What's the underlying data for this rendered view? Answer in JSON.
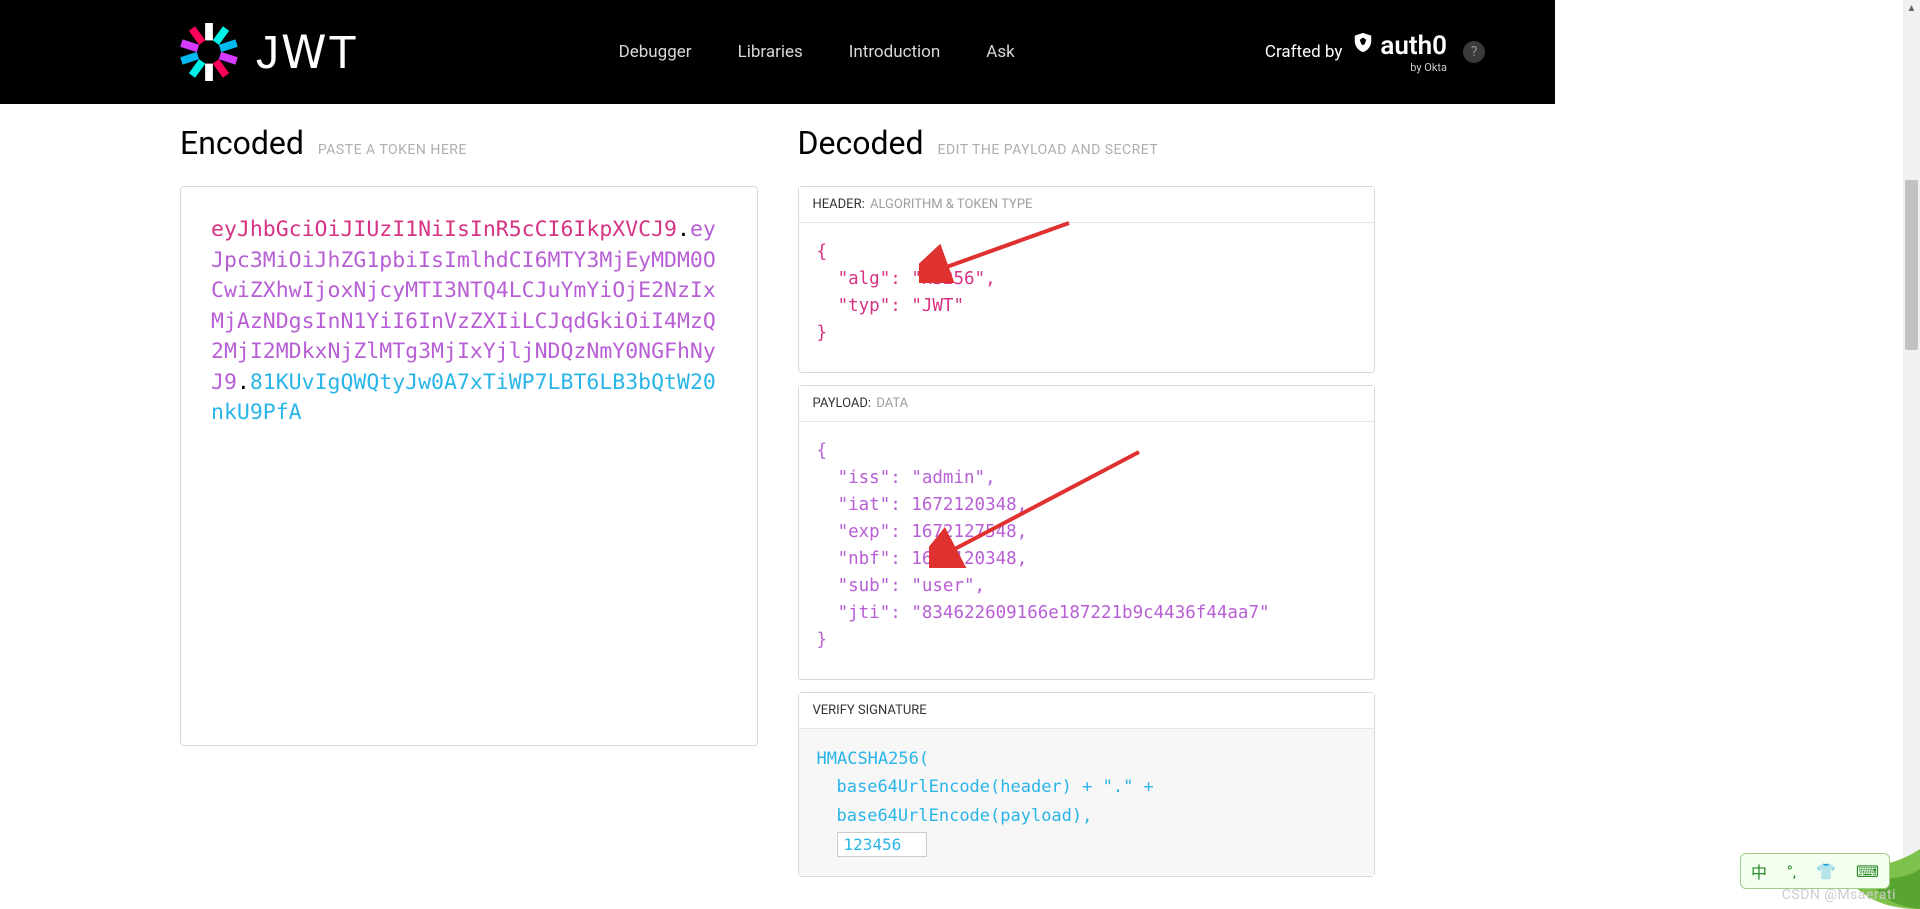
{
  "nav": {
    "links": {
      "debugger": "Debugger",
      "libraries": "Libraries",
      "introduction": "Introduction",
      "ask": "Ask"
    },
    "crafted_by": "Crafted by",
    "auth0": "auth0",
    "by_okta": "by Okta",
    "help": "?"
  },
  "encoded": {
    "title": "Encoded",
    "subtitle": "PASTE A TOKEN HERE",
    "token_header": "eyJhbGciOiJIUzI1NiIsInR5cCI6IkpXVCJ9",
    "token_payload": "eyJpc3MiOiJhZG1pbiIsImlhdCI6MTY3MjEyMDM0OCwiZXhwIjoxNjcyMTI3NTQ4LCJuYmYiOjE2NzIxMjAzNDgsInN1YiI6InVzZXIiLCJqdGkiOiI4MzQ2MjI2MDkxNjZlMTg3MjIxYjljNDQzNmY0NGFhNyJ9",
    "token_signature": "81KUvIgQWQtyJw0A7xTiWP7LBT6LB3bQtW20nkU9PfA"
  },
  "decoded": {
    "title": "Decoded",
    "subtitle": "EDIT THE PAYLOAD AND SECRET",
    "header_label": "HEADER:",
    "header_sublabel": "ALGORITHM & TOKEN TYPE",
    "header_json": {
      "alg": "HS256",
      "typ": "JWT"
    },
    "payload_label": "PAYLOAD:",
    "payload_sublabel": "DATA",
    "payload_json": {
      "iss": "admin",
      "iat": 1672120348,
      "exp": 1672127548,
      "nbf": 1672120348,
      "sub": "user",
      "jti": "834622609166e187221b9c4436f44aa7"
    },
    "sig_label": "VERIFY SIGNATURE",
    "sig": {
      "fn": "HMACSHA256(",
      "l1": "base64UrlEncode(header) + \".\" +",
      "l2": "base64UrlEncode(payload),",
      "secret": "123456"
    }
  },
  "ime": {
    "zh": "中",
    "dot1": "°",
    "icon2": "⌨"
  },
  "watermark": "CSDN @Msaerati"
}
